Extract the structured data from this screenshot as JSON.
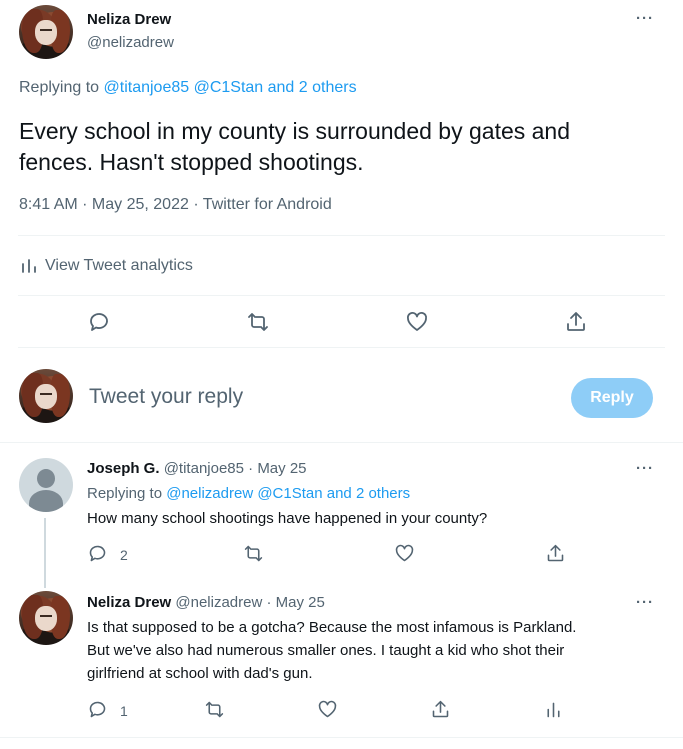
{
  "main_tweet": {
    "name": "Neliza Drew",
    "handle": "@nelizadrew",
    "replying_prefix": "Replying to",
    "replying_to": "@titanjoe85 @C1Stan and 2 others",
    "text_line1": "Every school in my county is surrounded by gates and",
    "text_line2": "fences. Hasn't stopped shootings.",
    "meta": "8:41 AM · May 25, 2022 · Twitter for Android",
    "analytics": "View Tweet analytics"
  },
  "compose": {
    "placeholder": "Tweet your reply",
    "button": "Reply"
  },
  "replies": [
    {
      "name": "Joseph G.",
      "handle": "@titanjoe85 · May 25",
      "replying_prefix": "Replying to",
      "replying_to": "@nelizadrew @C1Stan and 2 others",
      "text": "How many school shootings have happened in your county?",
      "reply_count": "2"
    },
    {
      "name": "Neliza Drew",
      "handle": "@nelizadrew · May 25",
      "text_line1": "Is that supposed to be a gotcha? Because the most infamous is Parkland.",
      "text_line2": "But we've also had numerous smaller ones. I taught a kid who shot their",
      "text_line3": "girlfriend at school with dad's gun.",
      "reply_count": "1"
    }
  ],
  "more_glyph": "···",
  "icons": [
    "reply-icon",
    "retweet-icon",
    "like-icon",
    "share-icon",
    "analytics-icon"
  ],
  "colors": {
    "link": "#1d9bf0",
    "muted": "#536471",
    "reply_button": "#8ecdf7"
  }
}
